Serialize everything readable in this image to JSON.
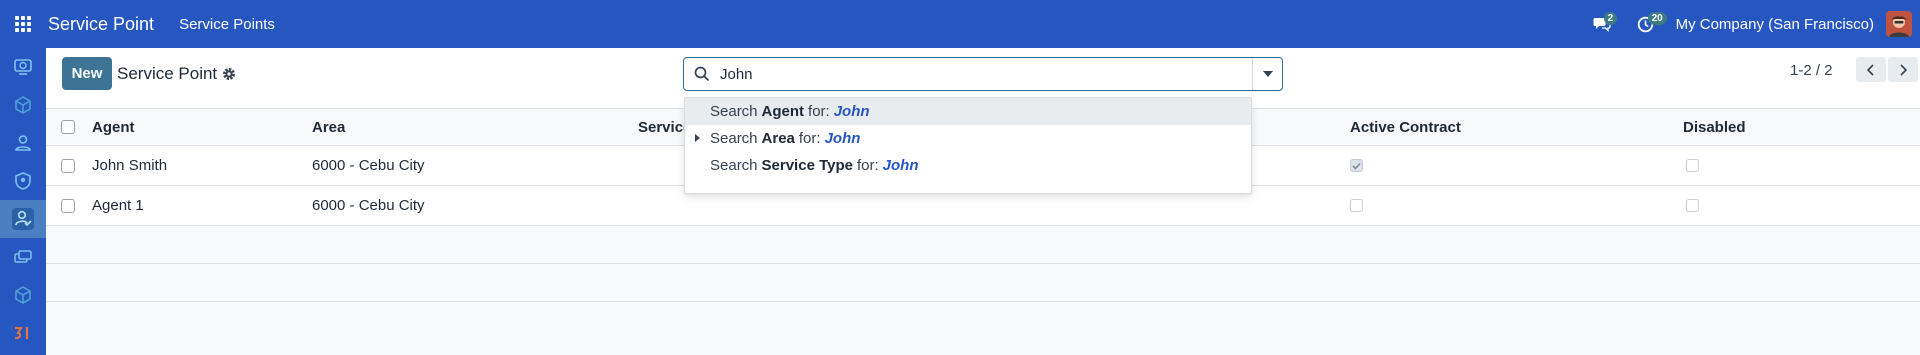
{
  "topbar": {
    "app_name": "Service Point",
    "menu": [
      "Service Points"
    ],
    "messages_count": "2",
    "activities_count": "20",
    "company": "My Company (San Francisco)"
  },
  "sidebar": {
    "items": [
      {
        "icon": "dashboard-icon",
        "color": "#4fa4d8"
      },
      {
        "icon": "cube-icon",
        "color": "#4fa4d8"
      },
      {
        "icon": "user-badge-icon",
        "color": "#4fa4d8"
      },
      {
        "icon": "shield-icon",
        "color": "#4fa4d8"
      },
      {
        "icon": "user-service-icon",
        "color": "#4fa4d8"
      },
      {
        "icon": "cards-icon",
        "color": "#4fa4d8"
      },
      {
        "icon": "cube-outline-icon",
        "color": "#4fa4d8"
      },
      {
        "icon": "brand-logo-icon",
        "color": "#e8743b"
      }
    ]
  },
  "control": {
    "new_label": "New",
    "title": "Service Point",
    "search_value": "John",
    "pager": "1-2 / 2"
  },
  "dropdown": {
    "items": [
      {
        "prefix": "Search",
        "field": "Agent",
        "suffix": "for:",
        "term": "John"
      },
      {
        "prefix": "Search",
        "field": "Area",
        "suffix": "for:",
        "term": "John"
      },
      {
        "prefix": "Search",
        "field": "Service Type",
        "suffix": "for:",
        "term": "John"
      }
    ]
  },
  "list": {
    "columns": [
      "Agent",
      "Area",
      "Service",
      "Active Contract",
      "Disabled"
    ],
    "rows": [
      {
        "agent": "John Smith",
        "area": "6000 - Cebu City",
        "active": true,
        "disabled": false
      },
      {
        "agent": "Agent 1",
        "area": "6000 - Cebu City",
        "active": false,
        "disabled": false
      }
    ]
  },
  "colors": {
    "navbar": "#2657c1",
    "primary_button": "#3d7395",
    "accent_text": "#2657c1"
  }
}
